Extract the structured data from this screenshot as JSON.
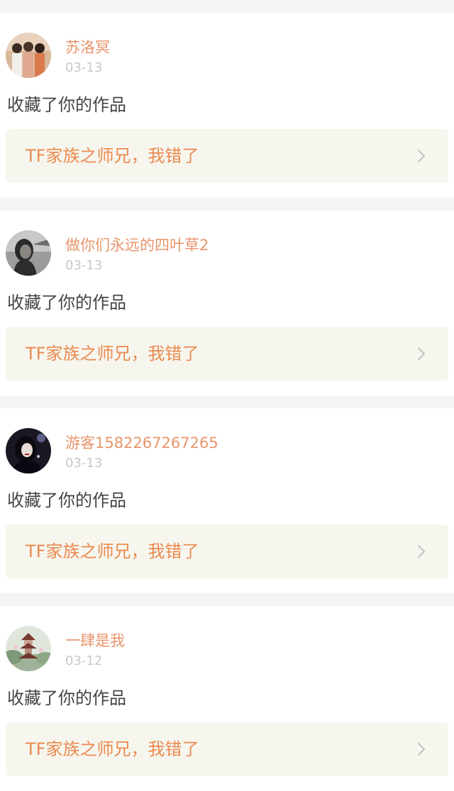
{
  "notifications": [
    {
      "username": "苏洛冥",
      "date": "03-13",
      "action": "收藏了你的作品",
      "work_title": "TF家族之师兄，我错了",
      "avatar_icon": "group-photo-avatar"
    },
    {
      "username": "做你们永远的四叶草2",
      "date": "03-13",
      "action": "收藏了你的作品",
      "work_title": "TF家族之师兄，我错了",
      "avatar_icon": "portrait-avatar"
    },
    {
      "username": "游客1582267267265",
      "date": "03-13",
      "action": "收藏了你的作品",
      "work_title": "TF家族之师兄，我错了",
      "avatar_icon": "dark-portrait-avatar"
    },
    {
      "username": "一肆是我",
      "date": "03-12",
      "action": "收藏了你的作品",
      "work_title": "TF家族之师兄，我错了",
      "avatar_icon": "pagoda-landscape-avatar"
    }
  ],
  "colors": {
    "username": "#e8956c",
    "work_title": "#eb8a4f",
    "link_bg": "#f6f6ee",
    "page_bg": "#f5f4f4"
  }
}
